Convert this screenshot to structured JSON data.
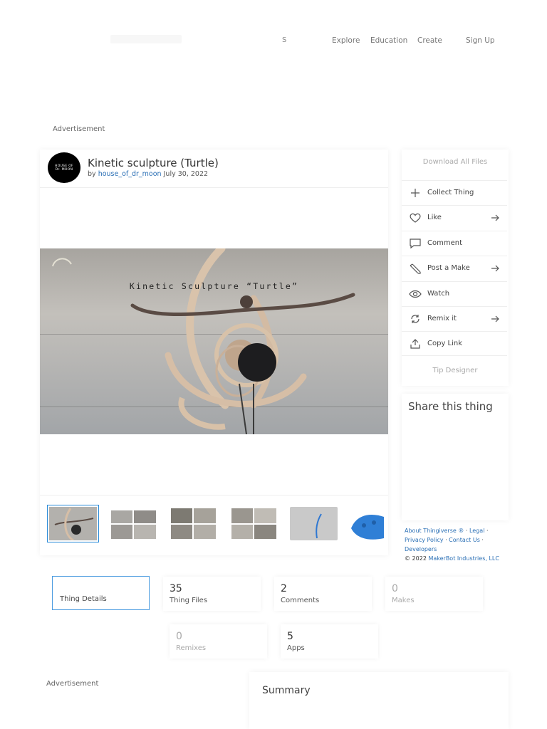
{
  "header": {
    "search_stub": "S",
    "nav": [
      "Explore",
      "Education",
      "Create",
      "Sign Up"
    ]
  },
  "ads": {
    "label_top": "Advertisement",
    "label_bottom": "Advertisement"
  },
  "thing": {
    "avatar_text": "HOUSE OF\nDr. MOON",
    "title": "Kinetic sculpture (Turtle)",
    "by_prefix": "by",
    "author": "house_of_dr_moon",
    "date": "July 30, 2022",
    "hero_caption": "Kinetic Sculpture “Turtle”"
  },
  "actions": {
    "download_all": "Download All Files",
    "items": [
      {
        "label": "Collect Thing",
        "icon": "plus-icon",
        "arrow": false
      },
      {
        "label": "Like",
        "icon": "heart-icon",
        "arrow": true
      },
      {
        "label": "Comment",
        "icon": "comment-icon",
        "arrow": false
      },
      {
        "label": "Post a Make",
        "icon": "pencil-icon",
        "arrow": true
      },
      {
        "label": "Watch",
        "icon": "eye-icon",
        "arrow": false
      },
      {
        "label": "Remix it",
        "icon": "remix-icon",
        "arrow": true
      },
      {
        "label": "Copy Link",
        "icon": "share-icon",
        "arrow": false
      }
    ],
    "tip_designer": "Tip Designer"
  },
  "share": {
    "title": "Share this thing"
  },
  "footer": {
    "about": "About Thingiverse ®",
    "legal": "Legal",
    "privacy": "Privacy Policy",
    "contact": "Contact Us",
    "developers": "Developers",
    "copyright_year": "© 2022",
    "company": "MakerBot Industries, LLC"
  },
  "stats": {
    "thing_details": "Thing Details",
    "thing_files": {
      "value": "35",
      "label": "Thing Files"
    },
    "comments": {
      "value": "2",
      "label": "Comments"
    },
    "makes": {
      "value": "0",
      "label": "Makes"
    },
    "remixes": {
      "value": "0",
      "label": "Remixes"
    },
    "apps": {
      "value": "5",
      "label": "Apps"
    }
  },
  "summary": {
    "title": "Summary"
  },
  "colors": {
    "link": "#2a6fb5",
    "selected_border": "#4a9be0",
    "thumb_active": "#2a8bd8"
  }
}
